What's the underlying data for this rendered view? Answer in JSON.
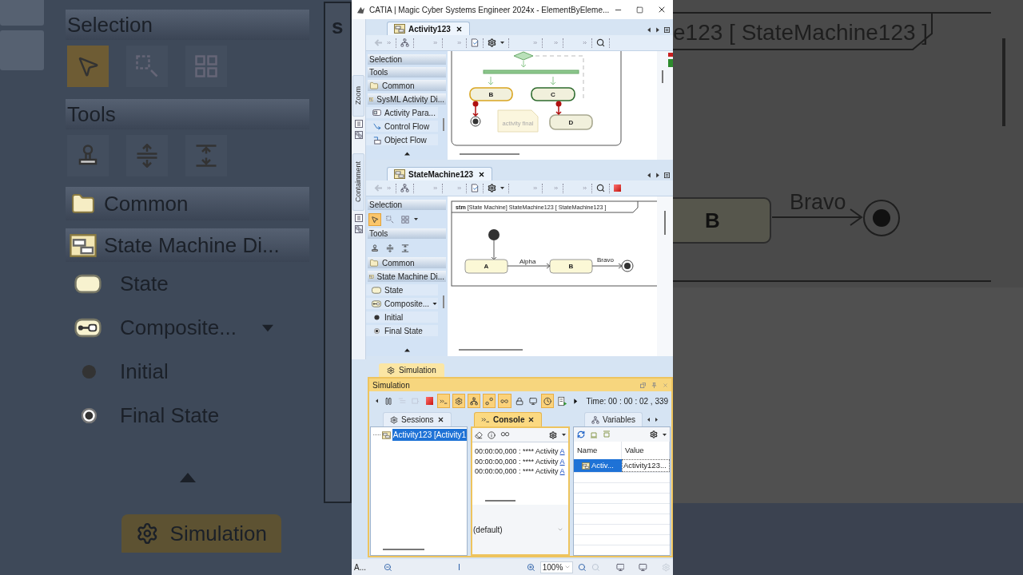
{
  "backdrop_left": {
    "palette": [
      {
        "kind": "header",
        "label": "Selection"
      },
      {
        "kind": "tools",
        "tools": [
          {
            "selected": true
          },
          {
            "selected": false
          },
          {
            "selected": false
          }
        ]
      },
      {
        "kind": "header",
        "label": "Tools"
      },
      {
        "kind": "tools",
        "tools": [
          {
            "selected": false
          },
          {
            "selected": false
          },
          {
            "selected": false
          }
        ]
      },
      {
        "kind": "group",
        "label": "Common"
      },
      {
        "kind": "group",
        "label": "State Machine Di..."
      },
      {
        "kind": "item",
        "label": "State",
        "menu": false
      },
      {
        "kind": "item",
        "label": "Composite...",
        "menu": true
      },
      {
        "kind": "item",
        "label": "Initial",
        "menu": false
      },
      {
        "kind": "item",
        "label": "Final State",
        "menu": false
      }
    ],
    "frame_fragment": "s",
    "tab": "Simulation"
  },
  "backdrop_right": {
    "frame_title": "e123 [ StateMachine123 ]",
    "state": "B",
    "transition": "Bravo"
  },
  "window": {
    "title": "CATIA | Magic Cyber Systems Engineer 2024x - ElementByEleme..."
  },
  "side_tabs": [
    {
      "label": "Zoom"
    },
    {
      "label": "Containment"
    }
  ],
  "activity_editor": {
    "tab": {
      "label": "Activity123",
      "selected": true
    },
    "palette": [
      {
        "kind": "header",
        "label": "Selection"
      },
      {
        "kind": "header",
        "label": "Tools"
      },
      {
        "kind": "group",
        "label": "Common"
      },
      {
        "kind": "group",
        "label": "SysML Activity Di..."
      },
      {
        "kind": "item",
        "label": "Activity Para...",
        "menu": false
      },
      {
        "kind": "item",
        "label": "Control Flow",
        "menu": false
      },
      {
        "kind": "item",
        "label": "Object Flow",
        "menu": false
      }
    ],
    "diagram": {
      "nodes": [
        {
          "label": "B",
          "color": "#d9a520"
        },
        {
          "label": "C",
          "color": "#2e6b2e"
        },
        {
          "label": "D",
          "color": "#a8a890"
        }
      ],
      "note": "activity final"
    }
  },
  "state_machine_editor": {
    "tab": {
      "label": "StateMachine123",
      "selected": true
    },
    "palette": [
      {
        "kind": "header",
        "label": "Selection"
      },
      {
        "kind": "tools",
        "tools": [
          {
            "selected": true
          },
          {
            "selected": false
          },
          {
            "selected": false
          }
        ]
      },
      {
        "kind": "header",
        "label": "Tools"
      },
      {
        "kind": "tools",
        "tools": [
          {
            "selected": false
          },
          {
            "selected": false
          },
          {
            "selected": false
          }
        ]
      },
      {
        "kind": "group",
        "label": "Common"
      },
      {
        "kind": "group",
        "label": "State Machine Di..."
      },
      {
        "kind": "item",
        "label": "State",
        "menu": false
      },
      {
        "kind": "item",
        "label": "Composite...",
        "menu": true
      },
      {
        "kind": "item",
        "label": "Initial",
        "menu": false
      },
      {
        "kind": "item",
        "label": "Final State",
        "menu": false
      }
    ],
    "diagram": {
      "keyword": "stm",
      "title": "[State Machine] StateMachine123 [ StateMachine123 ]",
      "states": [
        "A",
        "B"
      ],
      "transitions": [
        "Alpha",
        "Bravo"
      ]
    }
  },
  "simulation": {
    "tab": "Simulation",
    "title": "Simulation",
    "toolbar": [
      {
        "kind": "back",
        "on": false,
        "disabled": false
      },
      {
        "kind": "pause",
        "on": false,
        "disabled": false
      },
      {
        "kind": "stepinto",
        "on": false,
        "disabled": true
      },
      {
        "kind": "stepover",
        "on": false,
        "disabled": true
      },
      {
        "kind": "stop",
        "on": false,
        "disabled": false
      },
      {
        "kind": "console",
        "on": true,
        "disabled": false
      },
      {
        "kind": "gear",
        "on": true,
        "disabled": false
      },
      {
        "kind": "tree",
        "on": true,
        "disabled": false
      },
      {
        "kind": "nodes",
        "on": true,
        "disabled": false
      },
      {
        "kind": "loop",
        "on": true,
        "disabled": false
      },
      {
        "kind": "lock",
        "on": false,
        "disabled": false
      },
      {
        "kind": "screen",
        "on": false,
        "disabled": false
      },
      {
        "kind": "clock",
        "on": true,
        "disabled": false
      },
      {
        "kind": "export",
        "on": false,
        "disabled": false
      },
      {
        "kind": "play",
        "on": false,
        "disabled": false
      }
    ],
    "time": "Time: 00 : 00 : 02 , 339",
    "tabs": [
      {
        "label": "Sessions",
        "selected": false
      },
      {
        "label": "Console",
        "selected": true
      },
      {
        "label": "Variables",
        "selected": false
      }
    ],
    "sessions": [
      {
        "label": "Activity123 [Activity1",
        "selected": true
      }
    ],
    "console": {
      "lines": [
        {
          "text": "00:00:00,000 : **** Activity ",
          "link": "A"
        },
        {
          "text": "00:00:00,000 : **** Activity ",
          "link": "A"
        },
        {
          "text": "00:00:00,000 : **** Activity ",
          "link": "A"
        }
      ],
      "context": "(default)"
    },
    "variables": {
      "columns": [
        "Name",
        "Value"
      ],
      "rows": [
        {
          "name": "Activ...",
          "value": "Activity123...",
          "selected": true
        }
      ]
    }
  },
  "status_bar": {
    "text": "A...",
    "zoom": "100%"
  }
}
